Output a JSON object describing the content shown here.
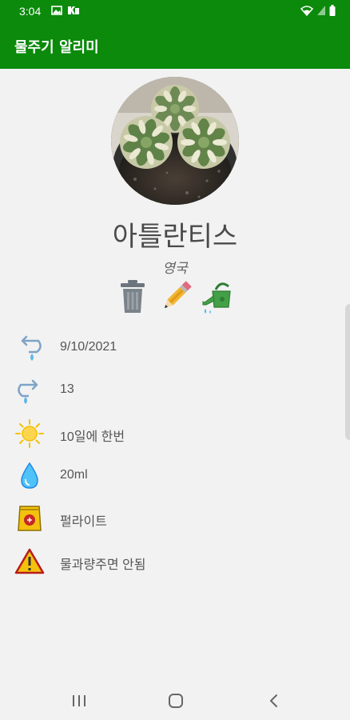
{
  "status": {
    "time": "3:04"
  },
  "app": {
    "title": "물주기 알리미"
  },
  "plant": {
    "name": "아틀란티스",
    "origin": "영국"
  },
  "actions": {
    "icons": [
      "trash-icon",
      "pencil-icon",
      "watering-can-icon"
    ]
  },
  "details": [
    {
      "icon": "last-watered-icon",
      "text": "9/10/2021"
    },
    {
      "icon": "next-watering-icon",
      "text": "13"
    },
    {
      "icon": "sun-icon",
      "text": "10일에 한번"
    },
    {
      "icon": "water-drop-icon",
      "text": "20ml"
    },
    {
      "icon": "soil-bag-icon",
      "text": "펄라이트"
    },
    {
      "icon": "warning-icon",
      "text": "물과량주면 안됨"
    }
  ],
  "colors": {
    "primary": "#0b8a0b",
    "background": "#f2f2f2"
  }
}
